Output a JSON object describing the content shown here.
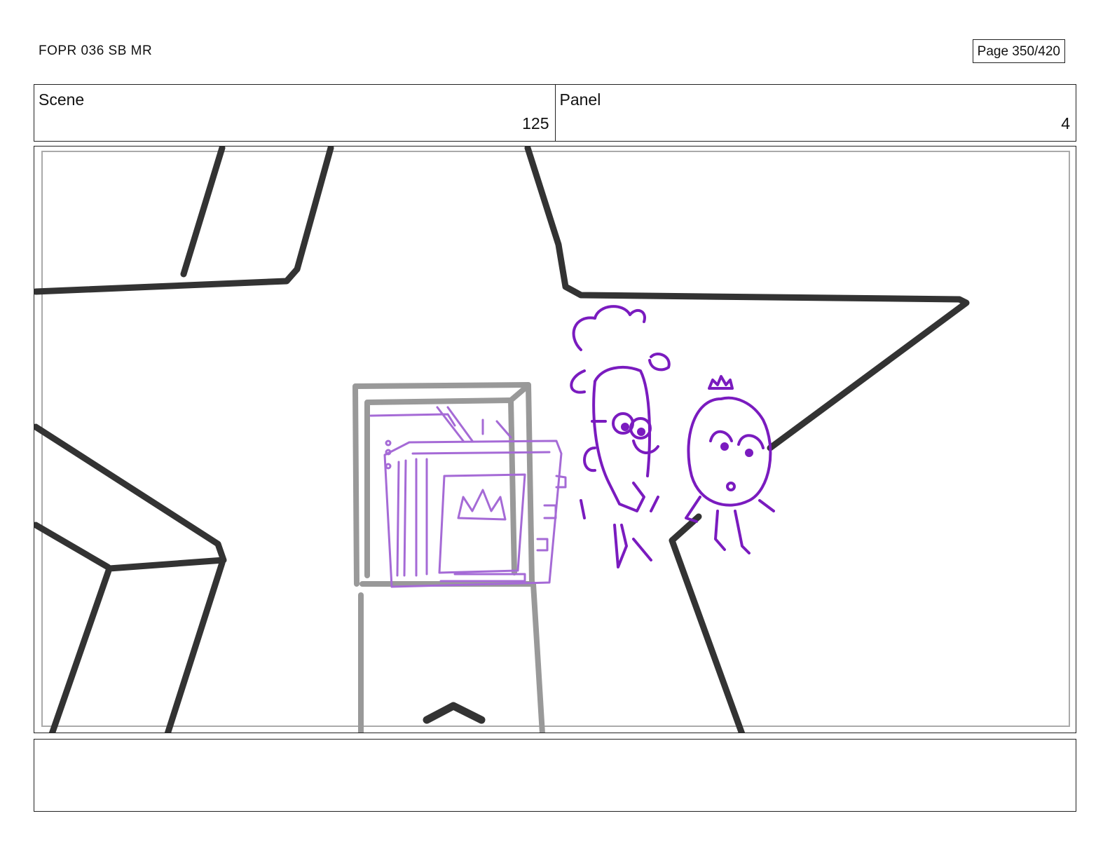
{
  "header": {
    "doc_title": "FOPR 036 SB MR",
    "page_label": "Page 350/420"
  },
  "info": {
    "scene_label": "Scene",
    "scene_number": "125",
    "panel_label": "Panel",
    "panel_number": "4"
  },
  "panel": {
    "description": "storyboard drawing"
  },
  "notes": {
    "text": ""
  },
  "colors": {
    "ink_dark": "#333333",
    "ink_gray": "#999999",
    "ink_purple": "#7a1bbf",
    "ink_light_purple": "#a56ad6"
  }
}
